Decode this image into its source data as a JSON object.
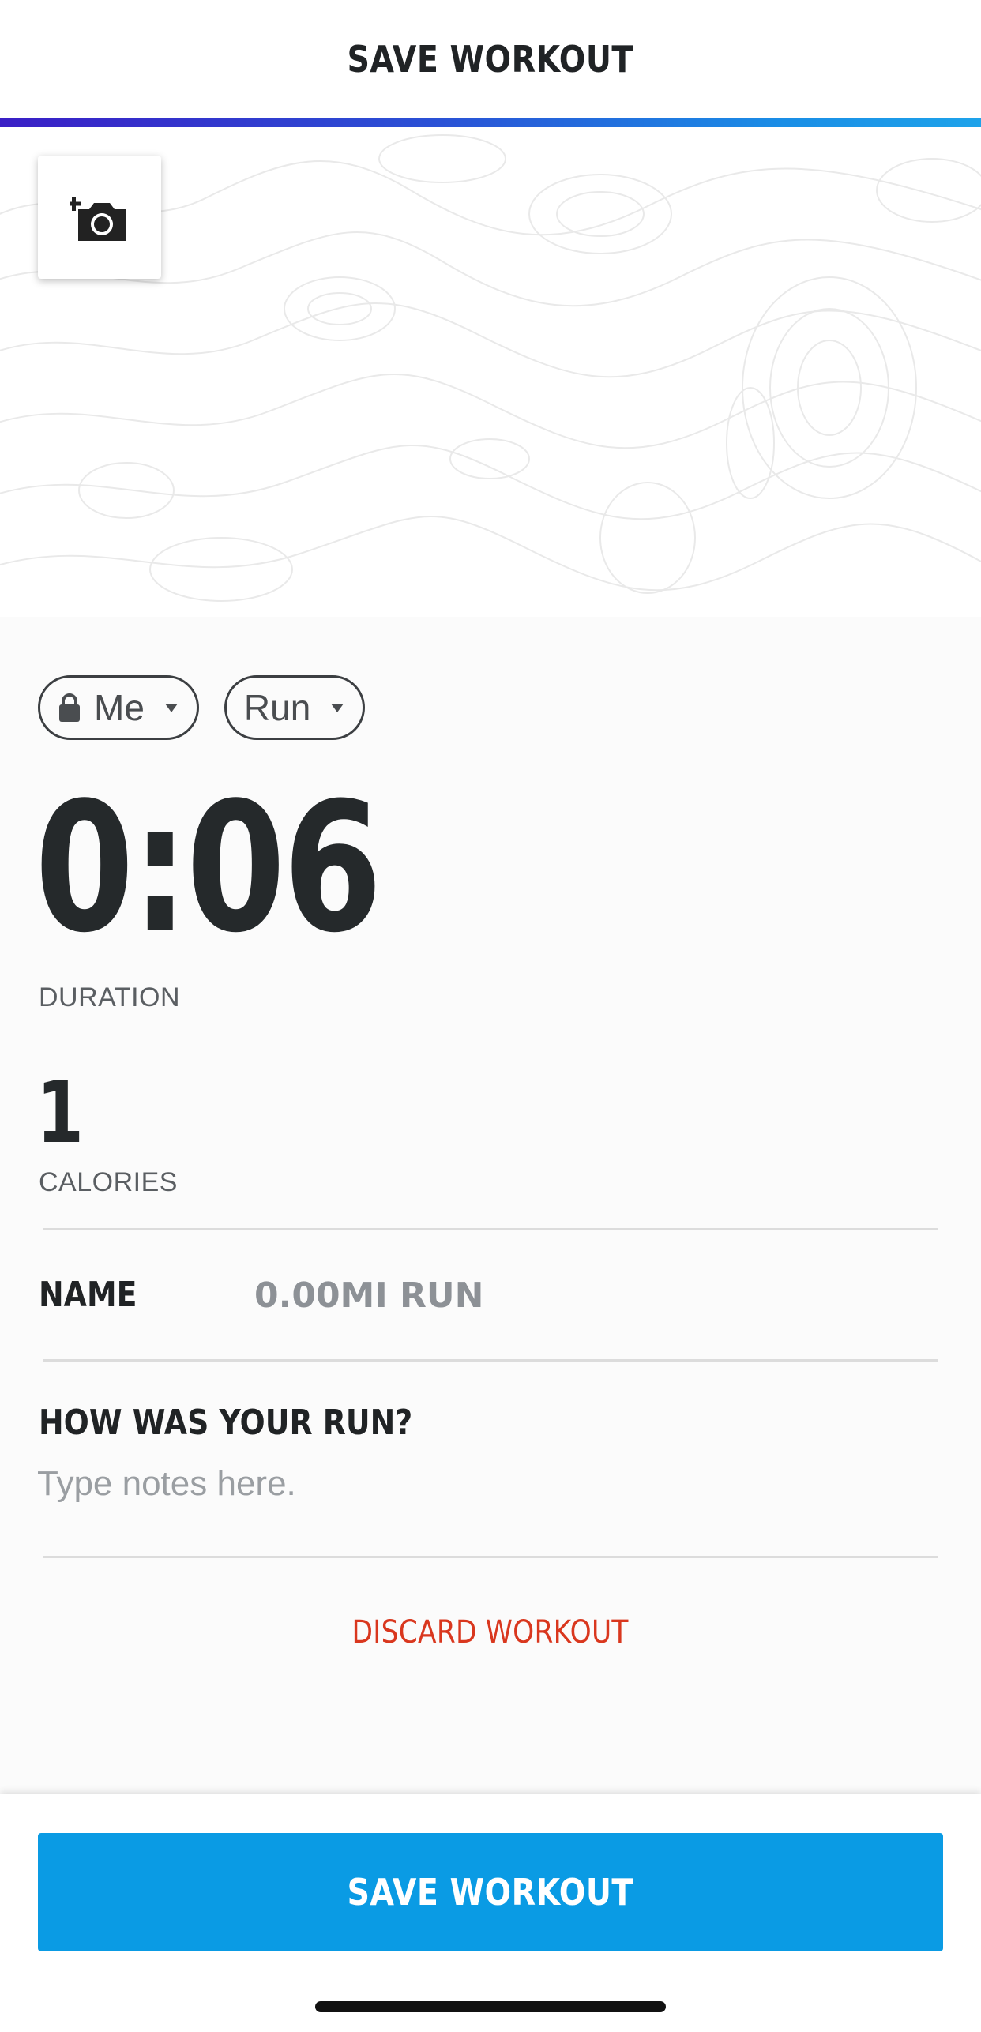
{
  "header": {
    "title": "SAVE WORKOUT"
  },
  "hero": {
    "add_photo_icon": "camera-plus-icon"
  },
  "privacy_pill": {
    "label": "Me",
    "icon": "lock-icon"
  },
  "activity_pill": {
    "label": "Run"
  },
  "stats": {
    "duration_value": "0:06",
    "duration_label": "DURATION",
    "calories_value": "1",
    "calories_label": "CALORIES"
  },
  "name_field": {
    "label": "NAME",
    "placeholder": "0.00MI RUN"
  },
  "notes": {
    "title": "HOW WAS YOUR RUN?",
    "placeholder": "Type notes here."
  },
  "discard_label": "DISCARD WORKOUT",
  "save_button": {
    "label": "SAVE WORKOUT"
  },
  "colors": {
    "accent_blue": "#0a9be4",
    "discard_red": "#d9371e",
    "header_gradient_start": "#3a1fc6",
    "header_gradient_end": "#1ea3ea"
  }
}
